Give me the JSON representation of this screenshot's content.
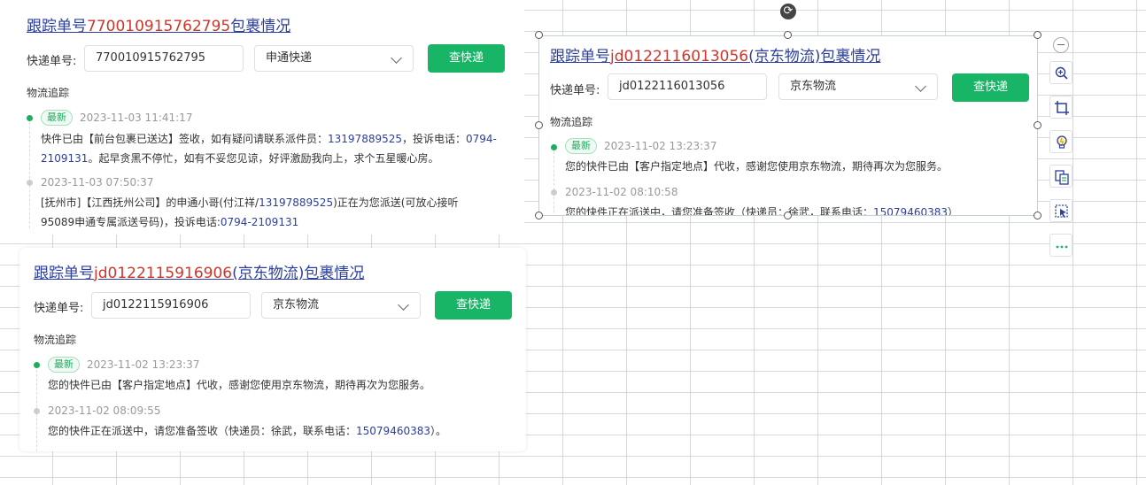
{
  "cards": {
    "card1": {
      "title_prefix": "跟踪单号",
      "title_number": "770010915762795",
      "title_suffix": "包裹情况",
      "label": "快递单号:",
      "input_value": "770010915762795",
      "carrier": "申通快递",
      "button": "查快递",
      "section": "物流追踪",
      "events": [
        {
          "badge": "最新",
          "time": "2023-11-03 11:41:17",
          "text_a": "快件已由【前台包裹已送达】签收，如有疑问请联系派件员：",
          "phone_a": "13197889525",
          "text_b": "，投诉电话：",
          "phone_b": "0794-2109131",
          "text_c": "。起早贪黑不停忙，如有不妥您见谅，好评激励我向上，求个五星暖心房。"
        },
        {
          "time": "2023-11-03 07:50:37",
          "text_a": "[抚州市]【江西抚州公司】的申通小哥(付江祥/",
          "phone_a": "13197889525",
          "text_b": ")正在为您派送(可放心接听95089申通专属派送号码)，投诉电话:",
          "phone_b": "0794-2109131"
        }
      ]
    },
    "card2": {
      "title_prefix": "跟踪单号",
      "title_number": "jd0122116013056",
      "title_suffix": "(京东物流)包裹情况",
      "label": "快递单号:",
      "input_value": "jd0122116013056",
      "carrier": "京东物流",
      "button": "查快递",
      "section": "物流追踪",
      "events": [
        {
          "badge": "最新",
          "time": "2023-11-02 13:23:37",
          "text_a": "您的快件已由【客户指定地点】代收，感谢您使用京东物流，期待再次为您服务。"
        },
        {
          "time": "2023-11-02 08:10:58",
          "text_a": "您的快件正在派送中，请您准备签收（快递员：徐武，联系电话：",
          "phone_a": "15079460383",
          "text_b": "）"
        }
      ]
    },
    "card3": {
      "title_prefix": "跟踪单号",
      "title_number": "jd0122115916906",
      "title_suffix": "(京东物流)包裹情况",
      "label": "快递单号:",
      "input_value": "jd0122115916906",
      "carrier": "京东物流",
      "button": "查快递",
      "section": "物流追踪",
      "events": [
        {
          "badge": "最新",
          "time": "2023-11-02 13:23:37",
          "text_a": "您的快件已由【客户指定地点】代收，感谢您使用京东物流，期待再次为您服务。"
        },
        {
          "time": "2023-11-02 08:09:55",
          "text_a": "您的快件正在派送中，请您准备签收（快递员：徐武，联系电话：",
          "phone_a": "15079460383",
          "text_b": "）。"
        }
      ]
    }
  },
  "toolbar": {
    "icons": [
      "collapse-icon",
      "zoom-in-icon",
      "crop-icon",
      "idea-icon",
      "convert-icon",
      "select-icon",
      "more-icon"
    ]
  },
  "colors": {
    "accent": "#18b566",
    "link": "#2c3e9e",
    "number": "#d0352b",
    "grid": "#d4d9de"
  }
}
